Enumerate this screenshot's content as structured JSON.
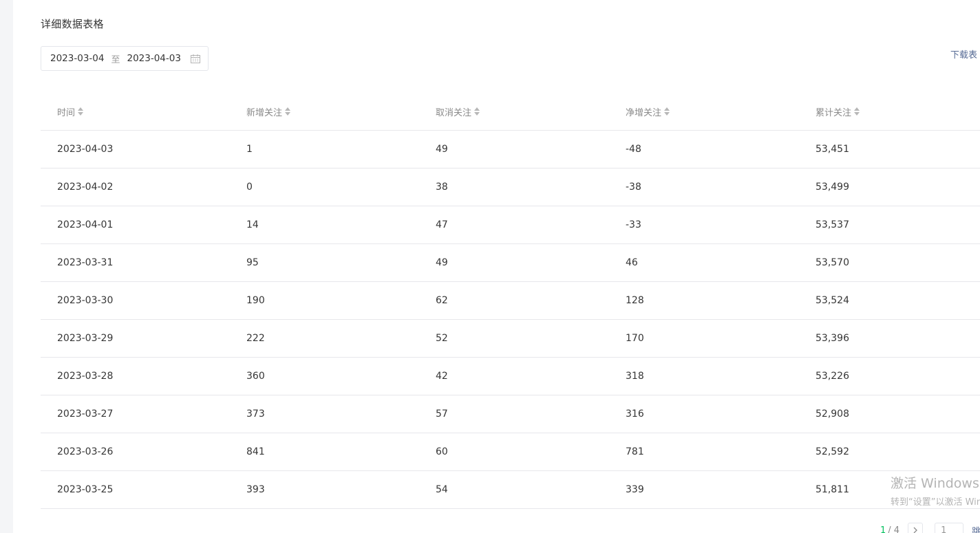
{
  "section": {
    "title": "详细数据表格"
  },
  "date_range": {
    "start": "2023-03-04",
    "separator": "至",
    "end": "2023-04-03",
    "icon": "calendar-icon"
  },
  "download": {
    "label": "下载表"
  },
  "table": {
    "columns": [
      "时间",
      "新增关注",
      "取消关注",
      "净增关注",
      "累计关注"
    ],
    "rows": [
      [
        "2023-04-03",
        "1",
        "49",
        "-48",
        "53,451"
      ],
      [
        "2023-04-02",
        "0",
        "38",
        "-38",
        "53,499"
      ],
      [
        "2023-04-01",
        "14",
        "47",
        "-33",
        "53,537"
      ],
      [
        "2023-03-31",
        "95",
        "49",
        "46",
        "53,570"
      ],
      [
        "2023-03-30",
        "190",
        "62",
        "128",
        "53,524"
      ],
      [
        "2023-03-29",
        "222",
        "52",
        "170",
        "53,396"
      ],
      [
        "2023-03-28",
        "360",
        "42",
        "318",
        "53,226"
      ],
      [
        "2023-03-27",
        "373",
        "57",
        "316",
        "52,908"
      ],
      [
        "2023-03-26",
        "841",
        "60",
        "781",
        "52,592"
      ],
      [
        "2023-03-25",
        "393",
        "54",
        "339",
        "51,811"
      ]
    ]
  },
  "pagination": {
    "current": "1",
    "total": "/ 4",
    "input_value": "1",
    "jump_label": "跳"
  },
  "watermark": {
    "line1": "激活 Windows",
    "line2": "转到“设置”以激活 Win"
  },
  "colors": {
    "link": "#576b95",
    "current_page": "#07c160",
    "border": "#e7e7eb"
  }
}
